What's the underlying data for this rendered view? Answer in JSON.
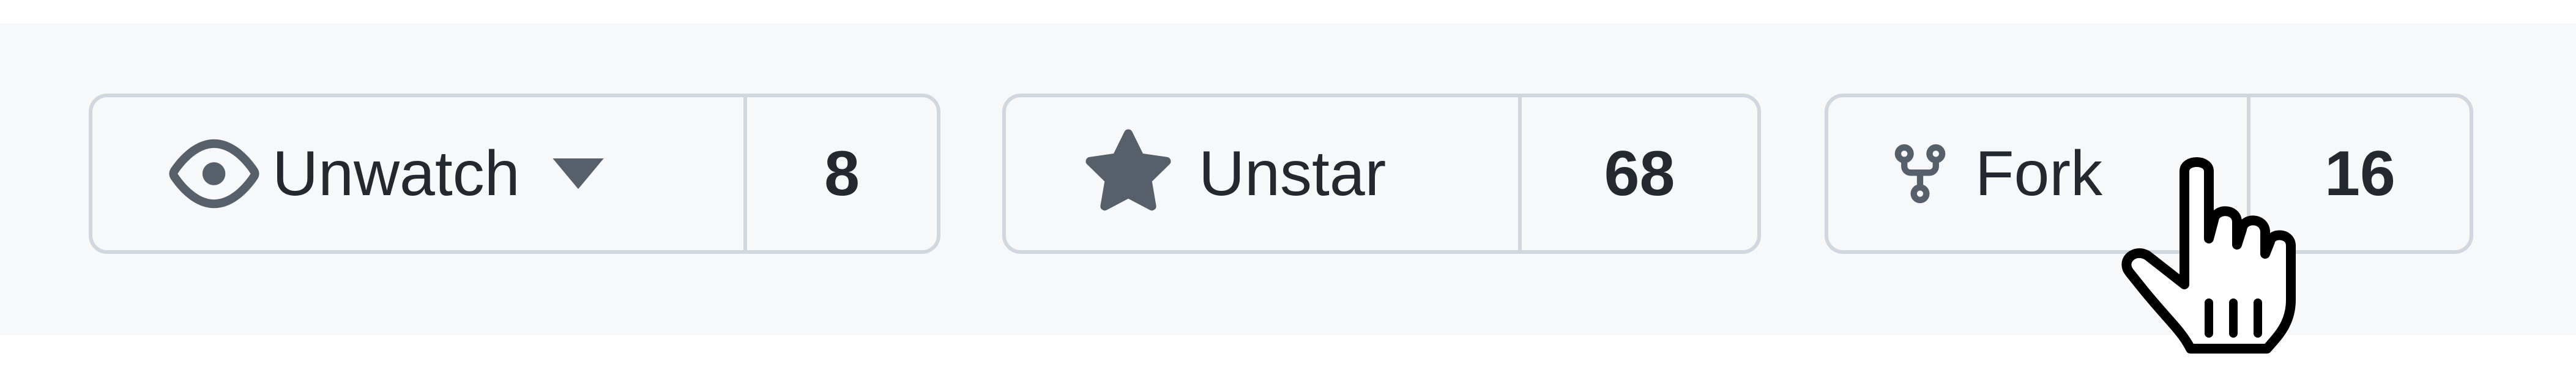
{
  "repo_actions": {
    "watch": {
      "label": "Unwatch",
      "count": "8",
      "icon": "eye-icon",
      "dropdown_icon": "caret-down-icon"
    },
    "star": {
      "label": "Unstar",
      "count": "68",
      "icon": "star-icon"
    },
    "fork": {
      "label": "Fork",
      "count": "16",
      "icon": "repo-forked-icon"
    }
  },
  "cursor": {
    "type": "pointer-hand-cursor"
  },
  "colors": {
    "background": "#f6f8fa",
    "border": "#d0d7de",
    "text": "#24292f",
    "icon": "#57606a"
  }
}
